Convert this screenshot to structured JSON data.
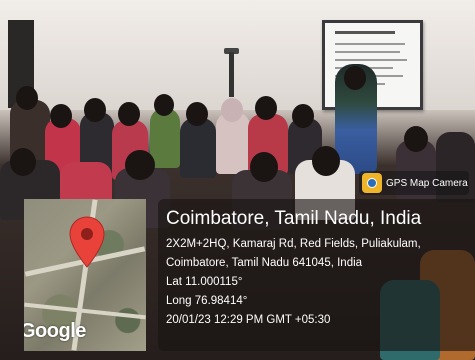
{
  "overlay": {
    "app_label": "GPS Map Camera",
    "city": "Coimbatore, Tamil Nadu, India",
    "address_line1": "2X2M+2HQ, Kamaraj Rd, Red Fields, Puliakulam,",
    "address_line2": "Coimbatore, Tamil Nadu 641045, India",
    "latitude": "Lat 11.000115°",
    "longitude": "Long 76.98414°",
    "datetime": "20/01/23 12:29 PM GMT +05:30"
  },
  "map": {
    "logo_text": "Google",
    "pin_color": "#e8423a"
  },
  "colors": {
    "overlay_bg": "#191412",
    "text": "#ffffff"
  }
}
